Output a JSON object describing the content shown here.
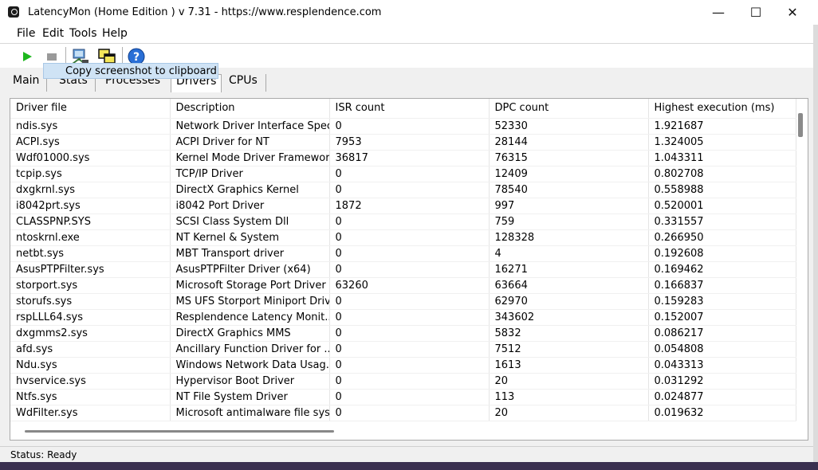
{
  "window": {
    "title": "LatencyMon  (Home Edition )  v 7.31 - https://www.resplendence.com",
    "minimize": "—",
    "maximize": "☐",
    "close": "✕"
  },
  "menu": {
    "file": "File",
    "edit": "Edit",
    "tools": "Tools",
    "help": "Help"
  },
  "toolbar": {
    "tooltip": "Copy screenshot to clipboard"
  },
  "tabs": {
    "main": "Main",
    "stats": "Stats",
    "processes": "Processes",
    "drivers": "Drivers",
    "cpus": "CPUs"
  },
  "columns": {
    "driver": "Driver file",
    "desc": "Description",
    "isr": "ISR count",
    "dpc": "DPC count",
    "exec": "Highest execution (ms)"
  },
  "rows": [
    {
      "driver": "ndis.sys",
      "desc": "Network Driver Interface Speci...",
      "isr": "0",
      "dpc": "52330",
      "exec": "1.921687"
    },
    {
      "driver": "ACPI.sys",
      "desc": "ACPI Driver for NT",
      "isr": "7953",
      "dpc": "28144",
      "exec": "1.324005"
    },
    {
      "driver": "Wdf01000.sys",
      "desc": "Kernel Mode Driver Framewor...",
      "isr": "36817",
      "dpc": "76315",
      "exec": "1.043311"
    },
    {
      "driver": "tcpip.sys",
      "desc": "TCP/IP Driver",
      "isr": "0",
      "dpc": "12409",
      "exec": "0.802708"
    },
    {
      "driver": "dxgkrnl.sys",
      "desc": "DirectX Graphics Kernel",
      "isr": "0",
      "dpc": "78540",
      "exec": "0.558988"
    },
    {
      "driver": "i8042prt.sys",
      "desc": "i8042 Port Driver",
      "isr": "1872",
      "dpc": "997",
      "exec": "0.520001"
    },
    {
      "driver": "CLASSPNP.SYS",
      "desc": "SCSI Class System Dll",
      "isr": "0",
      "dpc": "759",
      "exec": "0.331557"
    },
    {
      "driver": "ntoskrnl.exe",
      "desc": "NT Kernel & System",
      "isr": "0",
      "dpc": "128328",
      "exec": "0.266950"
    },
    {
      "driver": "netbt.sys",
      "desc": "MBT Transport driver",
      "isr": "0",
      "dpc": "4",
      "exec": "0.192608"
    },
    {
      "driver": "AsusPTPFilter.sys",
      "desc": "AsusPTPFilter Driver (x64)",
      "isr": "0",
      "dpc": "16271",
      "exec": "0.169462"
    },
    {
      "driver": "storport.sys",
      "desc": "Microsoft Storage Port Driver",
      "isr": "63260",
      "dpc": "63664",
      "exec": "0.166837"
    },
    {
      "driver": "storufs.sys",
      "desc": "MS UFS Storport Miniport Driver",
      "isr": "0",
      "dpc": "62970",
      "exec": "0.159283"
    },
    {
      "driver": "rspLLL64.sys",
      "desc": "Resplendence Latency Monit...",
      "isr": "0",
      "dpc": "343602",
      "exec": "0.152007"
    },
    {
      "driver": "dxgmms2.sys",
      "desc": "DirectX Graphics MMS",
      "isr": "0",
      "dpc": "5832",
      "exec": "0.086217"
    },
    {
      "driver": "afd.sys",
      "desc": "Ancillary Function Driver for ...",
      "isr": "0",
      "dpc": "7512",
      "exec": "0.054808"
    },
    {
      "driver": "Ndu.sys",
      "desc": "Windows Network Data Usag...",
      "isr": "0",
      "dpc": "1613",
      "exec": "0.043313"
    },
    {
      "driver": "hvservice.sys",
      "desc": "Hypervisor Boot Driver",
      "isr": "0",
      "dpc": "20",
      "exec": "0.031292"
    },
    {
      "driver": "Ntfs.sys",
      "desc": "NT File System Driver",
      "isr": "0",
      "dpc": "113",
      "exec": "0.024877"
    },
    {
      "driver": "WdFilter.sys",
      "desc": "Microsoft antimalware file sys...",
      "isr": "0",
      "dpc": "20",
      "exec": "0.019632"
    }
  ],
  "status": "Status: Ready"
}
